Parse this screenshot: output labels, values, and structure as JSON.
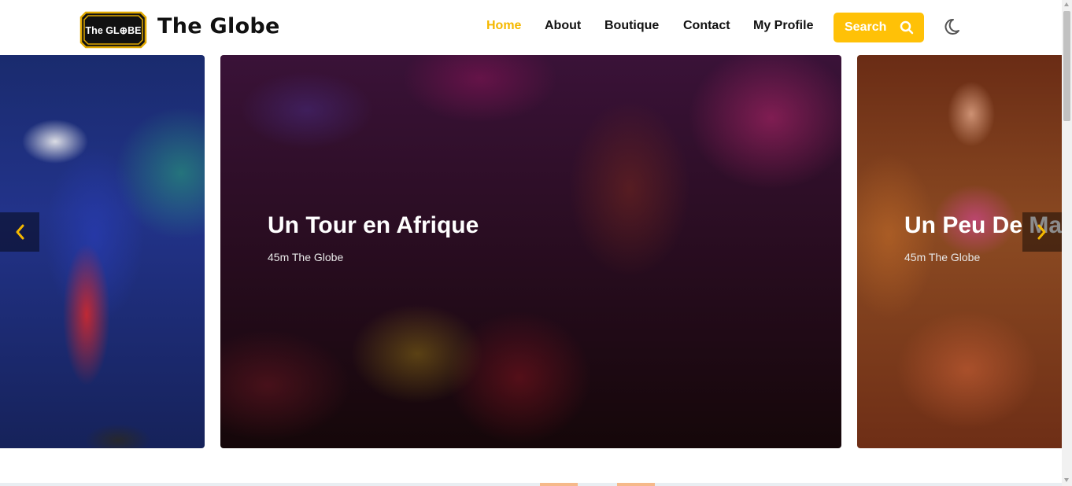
{
  "header": {
    "brand": "The Globe",
    "logo_text": "The GL⊕BE",
    "nav": [
      {
        "label": "Home",
        "active": true
      },
      {
        "label": "About",
        "active": false
      },
      {
        "label": "Boutique",
        "active": false
      },
      {
        "label": "Contact",
        "active": false
      },
      {
        "label": "My Profile",
        "active": false
      }
    ],
    "search_label": "Search",
    "search_icon": "search-icon",
    "theme_icon": "moon-icon",
    "accent_color": "#ffc107",
    "active_color": "#f5b800"
  },
  "carousel": {
    "slides": [
      {
        "title": "",
        "meta": ""
      },
      {
        "title": "Un Tour en Afrique",
        "meta": "45m The Globe"
      },
      {
        "title": "Un Peu De Ma",
        "meta": "45m The Globe"
      }
    ],
    "prev_icon": "chevron-left-icon",
    "next_icon": "chevron-right-icon"
  }
}
